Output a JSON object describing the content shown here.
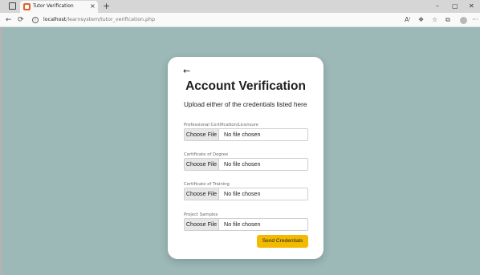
{
  "browser": {
    "tab_title": "Tutor Verification",
    "tab_close": "×",
    "new_tab": "+",
    "url_host": "localhost",
    "url_path": "/learnsystem/tutor_verification.php",
    "window_controls": [
      "–",
      "▢",
      "✕"
    ],
    "icons": [
      "window-menu-icon",
      "back-arrow-icon",
      "refresh-icon",
      "info-icon",
      "read-aloud-icon",
      "extensions-icon",
      "favorites-icon",
      "collections-icon",
      "profile-icon",
      "more-icon"
    ]
  },
  "page": {
    "background_color": "#9cb9b7",
    "back_arrow": "←",
    "title": "Account Verification",
    "subtitle": "Upload either of the credentials listed here",
    "fields": [
      {
        "label": "Professional Certification/Licensure",
        "button": "Choose File",
        "status": "No file chosen"
      },
      {
        "label": "Certificate of Degree",
        "button": "Choose File",
        "status": "No file chosen"
      },
      {
        "label": "Certificate of Training",
        "button": "Choose File",
        "status": "No file chosen"
      },
      {
        "label": "Project Samples",
        "button": "Choose File",
        "status": "No file chosen"
      }
    ],
    "submit_label": "Send Credentials",
    "submit_color": "#f2bb00"
  }
}
